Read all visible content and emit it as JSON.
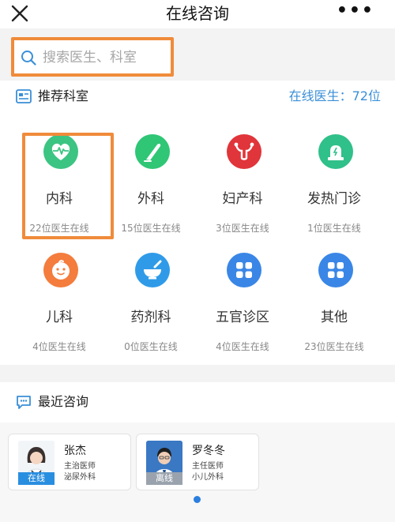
{
  "header": {
    "title": "在线咨询",
    "more": "•••"
  },
  "search": {
    "placeholder": "搜索医生、科室"
  },
  "recommend": {
    "title": "推荐科室",
    "online_label": "在线医生：72位"
  },
  "departments": [
    {
      "name": "内科",
      "count": "22位医生在线",
      "color": "#3cc482",
      "icon": "heart-pulse-icon"
    },
    {
      "name": "外科",
      "count": "15位医生在线",
      "color": "#2fc676",
      "icon": "scalpel-icon"
    },
    {
      "name": "妇产科",
      "count": "3位医生在线",
      "color": "#e0353a",
      "icon": "uterus-icon"
    },
    {
      "name": "发热门诊",
      "count": "1位医生在线",
      "color": "#30c08a",
      "icon": "alarm-light-icon"
    },
    {
      "name": "儿科",
      "count": "4位医生在线",
      "color": "#f47c3c",
      "icon": "baby-face-icon"
    },
    {
      "name": "药剂科",
      "count": "0位医生在线",
      "color": "#2f9be8",
      "icon": "mortar-icon"
    },
    {
      "name": "五官诊区",
      "count": "4位医生在线",
      "color": "#3a86e6",
      "icon": "grid-icon"
    },
    {
      "name": "其他",
      "count": "23位医生在线",
      "color": "#3a86e6",
      "icon": "grid-icon"
    }
  ],
  "recent": {
    "title": "最近咨询",
    "doctors": [
      {
        "name": "张杰",
        "title": "主治医师",
        "dept": "泌尿外科",
        "status": "在线",
        "status_color": "#2a8ee0"
      },
      {
        "name": "罗冬冬",
        "title": "主任医师",
        "dept": "小儿外科",
        "status": "离线",
        "status_color": "#9aa3ad"
      }
    ]
  },
  "colors": {
    "accent": "#3a8fd8",
    "highlight": "#f08b3a"
  }
}
